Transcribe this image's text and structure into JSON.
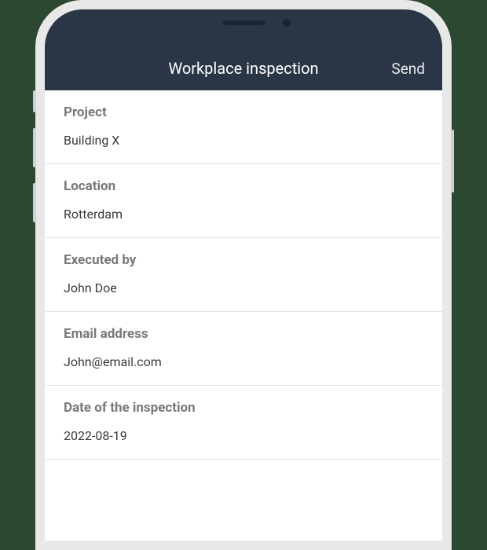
{
  "header": {
    "title": "Workplace inspection",
    "send_label": "Send"
  },
  "fields": [
    {
      "label": "Project",
      "value": "Building X"
    },
    {
      "label": "Location",
      "value": "Rotterdam"
    },
    {
      "label": "Executed by",
      "value": "John Doe"
    },
    {
      "label": "Email address",
      "value": "John@email.com"
    },
    {
      "label": "Date of the inspection",
      "value": "2022-08-19"
    }
  ]
}
